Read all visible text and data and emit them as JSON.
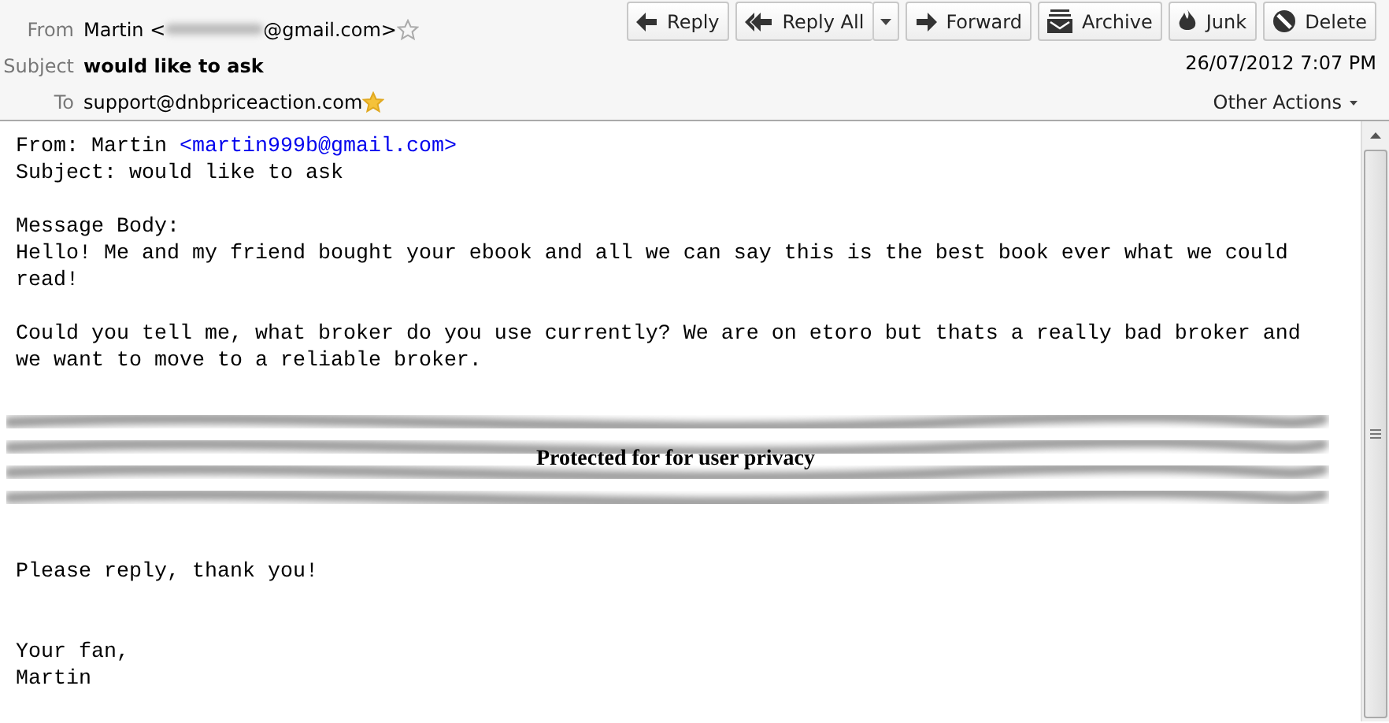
{
  "header": {
    "fields": [
      {
        "label": "From",
        "name": "Martin <",
        "redacted": true,
        "address": "@gmail.com>",
        "starred": false
      },
      {
        "label": "Subject",
        "value": "would like to ask"
      },
      {
        "label": "To",
        "address": "support@dnbpriceaction.com",
        "starred": true
      }
    ],
    "buttons": [
      {
        "kind": "reply",
        "label": "Reply"
      },
      {
        "kind": "replyall",
        "label": "Reply All",
        "dropdown": true
      },
      {
        "kind": "forward",
        "label": "Forward"
      },
      {
        "kind": "archive",
        "label": "Archive"
      },
      {
        "kind": "junk",
        "label": "Junk"
      },
      {
        "kind": "delete",
        "label": "Delete"
      }
    ],
    "date": "26/07/2012 7:07 PM",
    "other_actions": "Other Actions"
  },
  "body": {
    "from_prefix": "From: Martin ",
    "from_link": "<martin999b@gmail.com>",
    "subject_line": "Subject: would like to ask",
    "blocks": [
      {
        "kind": "text",
        "text": "Message Body:\nHello! Me and my friend bought your ebook and all we can say this is the best book ever what we could read!"
      },
      {
        "kind": "text",
        "text": "Could you tell me, what broker do you use currently? We are on etoro but thats a really bad broker and we want to move to a reliable broker."
      },
      {
        "kind": "redacted",
        "text": "Protected for for user privacy"
      },
      {
        "kind": "text",
        "text": "Please reply, thank you!"
      },
      {
        "kind": "spacer"
      },
      {
        "kind": "text",
        "text": "Your fan,\nMartin"
      }
    ]
  }
}
